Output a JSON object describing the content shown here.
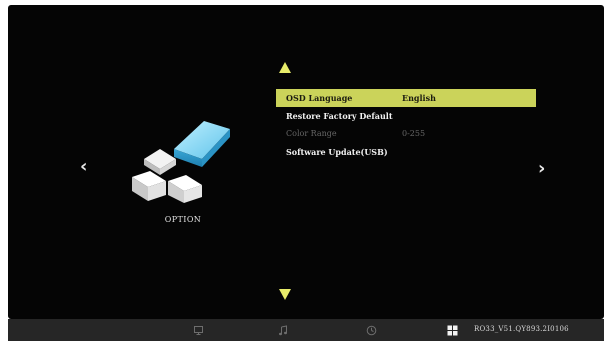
{
  "screen": {
    "category_label": "OPTION",
    "category_icon": "option-icon"
  },
  "navigation": {
    "left_arrow": "‹",
    "right_arrow": "›"
  },
  "menu": {
    "items": [
      {
        "label": "OSD Language",
        "value": "English",
        "state": "selected"
      },
      {
        "label": "Restore Factory Default",
        "value": "",
        "state": "normal"
      },
      {
        "label": "Color Range",
        "value": "0-255",
        "state": "disabled"
      },
      {
        "label": "Software Update(USB)",
        "value": "",
        "state": "normal"
      }
    ]
  },
  "bottom_bar": {
    "icons": [
      "monitor-icon",
      "music-icon",
      "clock-icon",
      "grid-icon"
    ],
    "version": "RO33_V51.QY893.2I0106"
  },
  "colors": {
    "highlight": "#cbd35a",
    "arrow_accent": "#e8ec6a",
    "background": "#050505",
    "bar": "#262626"
  }
}
